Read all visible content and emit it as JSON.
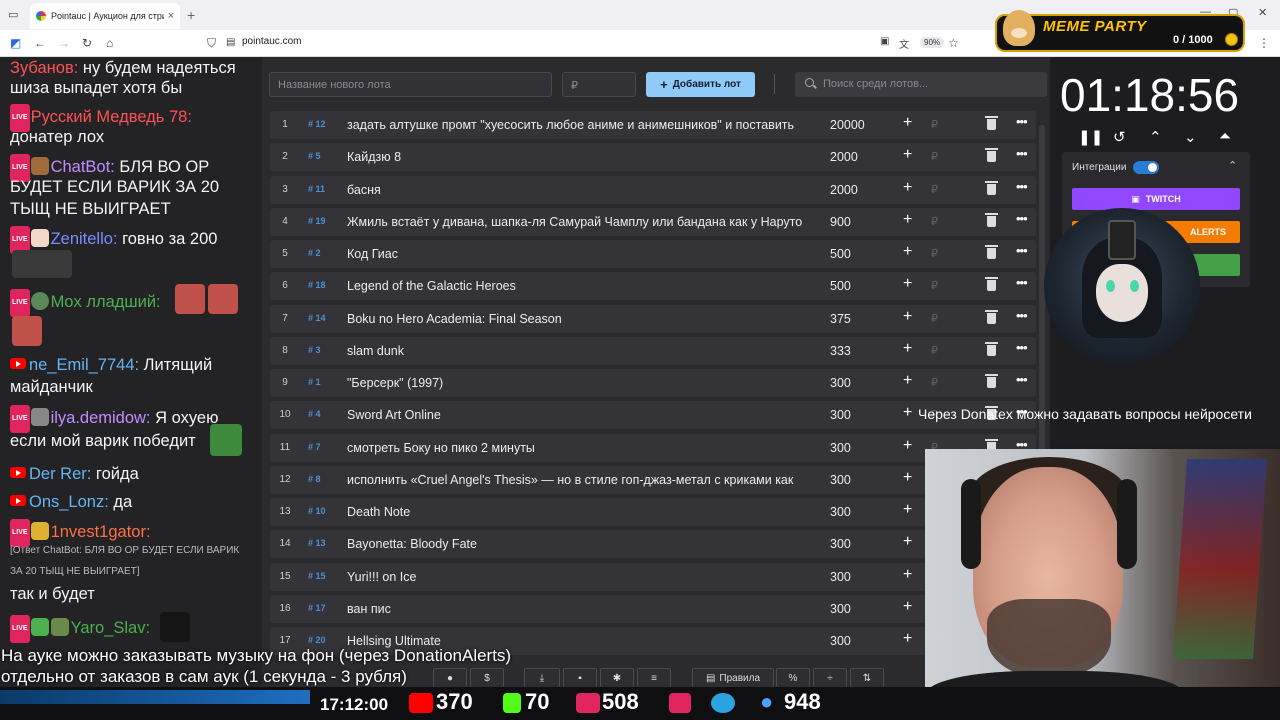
{
  "browser": {
    "tab_title": "Pointauc | Аукцион для стримеров",
    "url": "pointauc.com",
    "zoom": "90%"
  },
  "meme_party": {
    "title": "MEME PARTY",
    "count": "0 / 1000"
  },
  "app": {
    "new_lot_placeholder": "Название нового лота",
    "amount_placeholder": "₽",
    "add_button": "Добавить лот",
    "search_placeholder": "Поиск среди лотов...",
    "lots": [
      {
        "n": "1",
        "id": "# 12",
        "name": "задать алтушке промт \"хуесосить любое аниме и анимешников\" и поставить",
        "amount": "20000"
      },
      {
        "n": "2",
        "id": "# 5",
        "name": "Кайдзю 8",
        "amount": "2000"
      },
      {
        "n": "3",
        "id": "# 11",
        "name": "басня",
        "amount": "2000"
      },
      {
        "n": "4",
        "id": "# 19",
        "name": "Жмиль встаёт у дивана, шапка-ля Самурай Чамплу или бандана как у Наруто",
        "amount": "900"
      },
      {
        "n": "5",
        "id": "# 2",
        "name": "Код Гиас",
        "amount": "500"
      },
      {
        "n": "6",
        "id": "# 18",
        "name": "Legend of the Galactic Heroes",
        "amount": "500"
      },
      {
        "n": "7",
        "id": "# 14",
        "name": "Boku no Hero Academia: Final Season",
        "amount": "375"
      },
      {
        "n": "8",
        "id": "# 3",
        "name": " slam dunk",
        "amount": "333"
      },
      {
        "n": "9",
        "id": "# 1",
        "name": "\"Берсерк\" (1997)",
        "amount": "300"
      },
      {
        "n": "10",
        "id": "# 4",
        "name": "Sword Art Online",
        "amount": "300"
      },
      {
        "n": "11",
        "id": "# 7",
        "name": "смотреть Боку но пико 2 минуты",
        "amount": "300"
      },
      {
        "n": "12",
        "id": "# 8",
        "name": "исполнить «Cruel Angel's Thesis» — но в стиле гоп-джаз-метал с криками как",
        "amount": "300"
      },
      {
        "n": "13",
        "id": "# 10",
        "name": "Death Note",
        "amount": "300"
      },
      {
        "n": "14",
        "id": "# 13",
        "name": "Bayonetta: Bloody Fate",
        "amount": "300"
      },
      {
        "n": "15",
        "id": "# 15",
        "name": "Yuri!!! on Ice",
        "amount": "300"
      },
      {
        "n": "16",
        "id": "# 17",
        "name": "ван пис",
        "amount": "300"
      },
      {
        "n": "17",
        "id": "# 20",
        "name": "Hellsing Ultimate",
        "amount": "300"
      }
    ],
    "toolbar": {
      "rules": "Правила",
      "percent": "%"
    }
  },
  "timer": {
    "value": "01:18:56"
  },
  "integrations": {
    "label": "Интеграции",
    "twitch": "TWITCH",
    "alerts": "ALERTS"
  },
  "ticker": "Через Donatex можно задавать вопросы нейросети",
  "chat": {
    "l1_user": "Зубанов:",
    "l1_text": " ну будем надеяться",
    "l1b": "шиза выпадет хотя бы",
    "l2_user": "Русский Медведь 78:",
    "l2b": "донатер лох",
    "l3_user": "ChatBot:",
    "l3_text": " БЛЯ ВО ОР",
    "l3b": "БУДЕТ ЕСЛИ ВАРИК ЗА 20",
    "l3c": "ТЫЩ НЕ ВЫИГРАЕТ",
    "l4_user": "Zenitello:",
    "l4_text": " говно за 200",
    "l5_user": "Mox лладший:",
    "l6_user": "ne_Emil_7744:",
    "l6_text": " Литящий",
    "l6b": "майданчик",
    "l7_user": "ilya.demidow:",
    "l7_text": " Я охуею",
    "l7b": "если мой варик победит",
    "l8_user": "Der Rer:",
    "l8_text": " гойда",
    "l9_user": "Ons_Lonz:",
    "l9_text": " да",
    "l10_user": "1nvest1gator:",
    "l10b": "[Ответ ChatBot: БЛЯ ВО ОР БУДЕТ ЕСЛИ ВАРИК",
    "l10c": "ЗА 20 ТЫЩ НЕ ВЫИГРАЕТ]",
    "l10d": "так и будет",
    "l11_user": "Yaro_Slav:"
  },
  "subtitle": {
    "line1": "На ауке можно заказывать музыку на фон (через DonationAlerts)",
    "line2": "отдельно от заказов в сам аук (1 секунда - 3 рубля)"
  },
  "status": {
    "clock": "17:12:00",
    "youtube": "370",
    "kick": "70",
    "live": "508",
    "viewers": "948"
  },
  "colors": {
    "accent": "#90caf9",
    "twitch": "#9146ff",
    "alerts": "#f57c00",
    "live": "#e0245e"
  }
}
